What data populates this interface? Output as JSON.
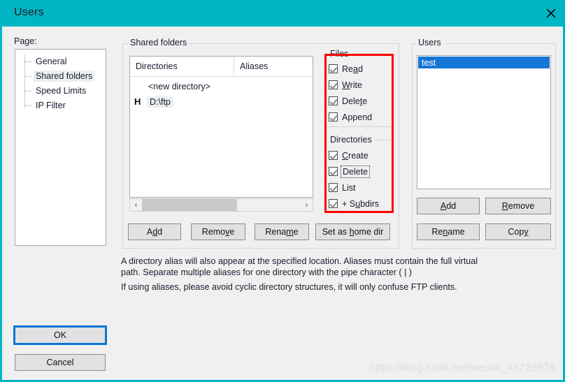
{
  "window": {
    "title": "Users",
    "close_icon": "close-icon"
  },
  "left": {
    "page_label": "Page:",
    "tree_items": [
      {
        "label": "General",
        "selected": false
      },
      {
        "label": "Shared folders",
        "selected": true
      },
      {
        "label": "Speed Limits",
        "selected": false
      },
      {
        "label": "IP Filter",
        "selected": false
      }
    ],
    "ok_label": "OK",
    "cancel_label": "Cancel"
  },
  "shared_folders": {
    "group_title": "Shared folders",
    "columns": [
      "Directories",
      "Aliases"
    ],
    "rows": [
      {
        "flag": "",
        "dir": "<new directory>",
        "alias": "",
        "selected": false
      },
      {
        "flag": "H",
        "dir": "D:\\ftp",
        "alias": "",
        "selected": true
      }
    ],
    "scrollbar": {
      "left_arrow": "‹",
      "right_arrow": "›",
      "thumb_percent": 60
    },
    "buttons": [
      {
        "label": "Add",
        "accel": "d"
      },
      {
        "label": "Remove",
        "accel": "v"
      },
      {
        "label": "Rename",
        "accel": "m"
      },
      {
        "label": "Set as home dir",
        "accel": "h"
      }
    ]
  },
  "files_group": {
    "title": "Files",
    "checkboxes": [
      {
        "label": "Read",
        "accel": "a",
        "checked": true,
        "focused": false
      },
      {
        "label": "Write",
        "accel": "W",
        "checked": true,
        "focused": false
      },
      {
        "label": "Delete",
        "accel": "t",
        "checked": true,
        "focused": false
      },
      {
        "label": "Append",
        "accel": "",
        "checked": true,
        "focused": false
      }
    ]
  },
  "directories_group": {
    "title": "Directories",
    "checkboxes": [
      {
        "label": "Create",
        "accel": "C",
        "checked": true,
        "focused": false
      },
      {
        "label": "Delete",
        "accel": "",
        "checked": true,
        "focused": true
      },
      {
        "label": "List",
        "accel": "",
        "checked": true,
        "focused": false
      },
      {
        "label": "+ Subdirs",
        "accel": "u",
        "checked": true,
        "focused": false
      }
    ]
  },
  "users_group": {
    "title": "Users",
    "list": [
      {
        "label": "test",
        "selected": true
      }
    ],
    "buttons": [
      {
        "label": "Add",
        "accel": "A"
      },
      {
        "label": "Remove",
        "accel": "R"
      },
      {
        "label": "Rename",
        "accel": "n"
      },
      {
        "label": "Copy",
        "accel": "y"
      }
    ]
  },
  "description": {
    "line1": "A directory alias will also appear at the specified location. Aliases must contain the full virtual",
    "line2": "path. Separate multiple aliases for one directory with the pipe character ( | )",
    "line3": "If using aliases, please avoid cyclic directory structures, it will only confuse FTP clients."
  },
  "watermark": {
    "text": "https://blog.csdn.net/weixin_45728976"
  },
  "colors": {
    "titlebar": "#00b6c4",
    "selection": "#1477d6",
    "highlight_box": "#ff0000",
    "dialog_bg": "#f0f0f0"
  }
}
